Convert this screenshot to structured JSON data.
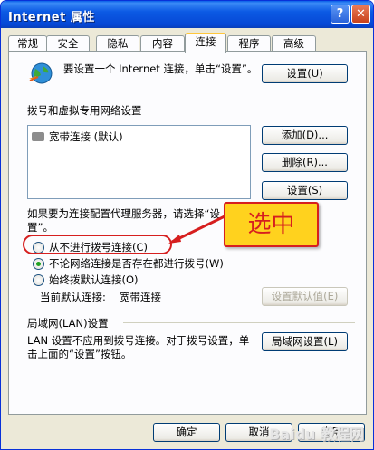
{
  "window": {
    "title": "Internet 属性",
    "help": "?",
    "close": "✕"
  },
  "tabs": [
    "常规",
    "安全",
    "隐私",
    "内容",
    "连接",
    "程序",
    "高级"
  ],
  "active_tab": "连接",
  "setup": {
    "description": "要设置一个 Internet 连接，单击“设置”。",
    "button": "设置(U)"
  },
  "dialup": {
    "section": "拨号和虚拟专用网络设置",
    "items": [
      "宽带连接 (默认)"
    ],
    "add": "添加(D)...",
    "remove": "删除(R)...",
    "settings": "设置(S)"
  },
  "proxy": {
    "prompt": "如果要为连接配置代理服务器，请选择“设置”。",
    "options": [
      "从不进行拨号连接(C)",
      "不论网络连接是否存在都进行拨号(W)",
      "始终拨默认连接(O)"
    ],
    "selected_index": 1,
    "current_default_label": "当前默认连接:",
    "current_default_value": "宽带连接",
    "set_default": "设置默认值(E)"
  },
  "lan": {
    "section": "局域网(LAN)设置",
    "description": "LAN 设置不应用到拨号连接。对于拨号设置，单击上面的“设置”按钮。",
    "button": "局域网设置(L)"
  },
  "footer": {
    "ok": "确定",
    "cancel": "取消",
    "apply": "应用"
  },
  "annotation": {
    "callout": "选中"
  },
  "watermark": "Baidu 教程网"
}
